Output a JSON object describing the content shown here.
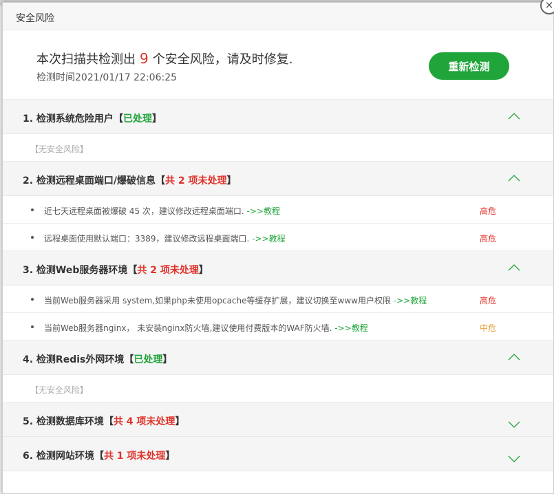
{
  "dialog": {
    "title": "安全风险",
    "close_label": "×"
  },
  "summary": {
    "prefix": "本次扫描共检测出",
    "count": "9",
    "suffix": "个安全风险，请及时修复.",
    "scan_time": "检测时间2021/01/17 22:06:25",
    "rescan_label": "重新检测"
  },
  "colors": {
    "accent_green": "#20a53a",
    "risk_red": "#e0332a",
    "risk_orange": "#e6a23c"
  },
  "sections": [
    {
      "title": "1. 检测系统危险用户",
      "tag": "已处理",
      "status": "ok",
      "expanded": true,
      "chevron_icon": "chevron-up-icon",
      "empty_text": "【无安全风险】",
      "items": []
    },
    {
      "title": "2. 检测远程桌面端口/爆破信息",
      "tag": "共 2 项未处理",
      "status": "bad",
      "expanded": true,
      "chevron_icon": "chevron-up-icon",
      "items": [
        {
          "text": "近七天远程桌面被爆破 45 次，建议修改远程桌面端口. ",
          "link": "->>教程",
          "level": "高危",
          "level_type": "high"
        },
        {
          "text": "远程桌面使用默认端口：3389，建议修改远程桌面端口. ",
          "link": "->>教程",
          "level": "高危",
          "level_type": "high"
        }
      ]
    },
    {
      "title": "3. 检测Web服务器环境",
      "tag": "共 2 项未处理",
      "status": "bad",
      "expanded": true,
      "chevron_icon": "chevron-up-icon",
      "items": [
        {
          "text": "当前Web服务器采用 system,如果php未使用opcache等缓存扩展，建议切换至www用户权限 ",
          "link": "->>教程",
          "level": "高危",
          "level_type": "high"
        },
        {
          "text": "当前Web服务器nginx， 未安装nginx防火墙,建议使用付费版本的WAF防火墙. ",
          "link": "->>教程",
          "level": "中危",
          "level_type": "mid"
        }
      ]
    },
    {
      "title": "4. 检测Redis外网环境",
      "tag": "已处理",
      "status": "ok",
      "expanded": true,
      "chevron_icon": "chevron-up-icon",
      "empty_text": "【无安全风险】",
      "items": []
    },
    {
      "title": "5. 检测数据库环境",
      "tag": "共 4 项未处理",
      "status": "bad",
      "expanded": false,
      "chevron_icon": "chevron-down-icon",
      "items": []
    },
    {
      "title": "6. 检测网站环境",
      "tag": "共 1 项未处理",
      "status": "bad",
      "expanded": false,
      "chevron_icon": "chevron-down-icon",
      "items": []
    }
  ]
}
